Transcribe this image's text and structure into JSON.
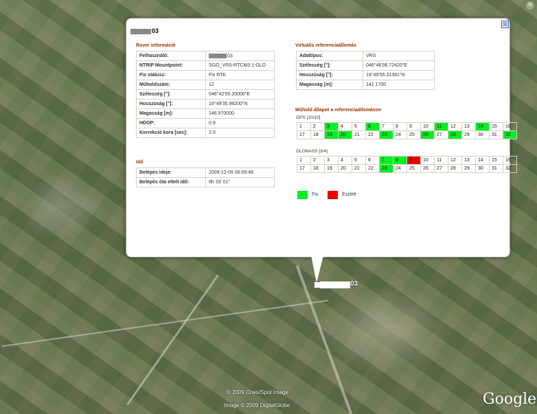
{
  "popup": {
    "title_suffix": "03",
    "close_glyph": "⊠",
    "rover": {
      "heading": "Rover információ",
      "rows": [
        {
          "k": "Felhasználó:",
          "v": "03",
          "redacted": true
        },
        {
          "k": "NTRIP Mountpoint:",
          "v": "SGO_VRS-RTCM3.1-GLO"
        },
        {
          "k": "Fix státusz:",
          "v": "Fix RTK"
        },
        {
          "k": "Műholdszám:",
          "v": "12"
        },
        {
          "k": "Szélesség [°]:",
          "v": "046°42'55.20000\"E"
        },
        {
          "k": "Hosszúság [°]:",
          "v": "19°49'35.98200\"N"
        },
        {
          "k": "Magasság [m]:",
          "v": "146.970000"
        },
        {
          "k": "HDOP:",
          "v": "0.9"
        },
        {
          "k": "Korrekció kora [sec]:",
          "v": "2.0"
        }
      ]
    },
    "ido": {
      "heading": "Idő",
      "rows": [
        {
          "k": "Belépés ideje:",
          "v": "2009-12-09 06:09:48"
        },
        {
          "k": "Belépés óta eltelt idő:",
          "v": "8h 33' 01\""
        }
      ]
    },
    "vrs": {
      "heading": "Virtuális referenciaállomás",
      "rows": [
        {
          "k": "Adattípus:",
          "v": "VRS"
        },
        {
          "k": "Szélesség [°]:",
          "v": "046°46'06.72420\"E"
        },
        {
          "k": "Hosszúság [°]:",
          "v": "19°49'55.31391\"N"
        },
        {
          "k": "Magasság [m]:",
          "v": "142.1700"
        }
      ]
    },
    "sats": {
      "heading": "Műhold állapot a referenciaállomáson",
      "gps_label": "GPS [10/10]",
      "glonass_label": "GLONASS [3/4]",
      "gps_fix": [
        3,
        6,
        11,
        14,
        19,
        20,
        23,
        26,
        28,
        32
      ],
      "gps_obs": [],
      "glonass_fix": [
        7,
        8,
        23
      ],
      "glonass_obs": [
        9
      ]
    },
    "legend": {
      "fix": "Fix",
      "obs": "Észlelt",
      "fix_color": "#00ee22",
      "obs_color": "#ee0000"
    }
  },
  "map": {
    "marker_label": "03",
    "credit_1": "© 2009 Cnes/Spot Image",
    "credit_2": "Image © 2009 DigitalGlobe",
    "logo": "Google",
    "compass_n": "N"
  }
}
